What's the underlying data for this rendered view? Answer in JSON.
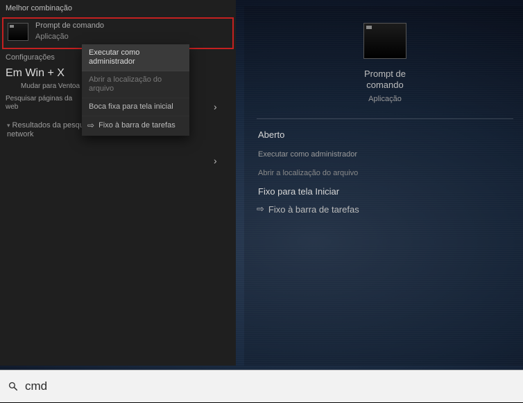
{
  "header": {
    "melhor": "Melhor combinação"
  },
  "best_match": {
    "title": "Prompt de comando",
    "subtitle": "Aplicação"
  },
  "sections": {
    "configuracoes": "Configurações",
    "winx": "Em Win + X",
    "mudar": "Mudar para Ventoa",
    "pesquisar": "Pesquisar páginas da web"
  },
  "results": {
    "cmd_view": "Resultados da pesquisa: cmd-view network"
  },
  "chevron": "›",
  "context_menu": {
    "run_admin": "Executar como administrador",
    "open_loc": "Abrir a localização do arquivo",
    "pin_start": "Boca fixa para tela inicial",
    "pin_task": "Fixo à barra de tarefas"
  },
  "pin_glyph": "⇨",
  "detail": {
    "title": "Prompt de comando",
    "subtitle": "Aplicação",
    "aberto": "Aberto",
    "run_admin": "Executar como administrador",
    "open_loc": "Abrir a localização do arquivo",
    "pin_start": "Fixo para tela Iniciar",
    "pin_task": "Fixo à barra de tarefas"
  },
  "search": {
    "value": "cmd",
    "placeholder": ""
  }
}
